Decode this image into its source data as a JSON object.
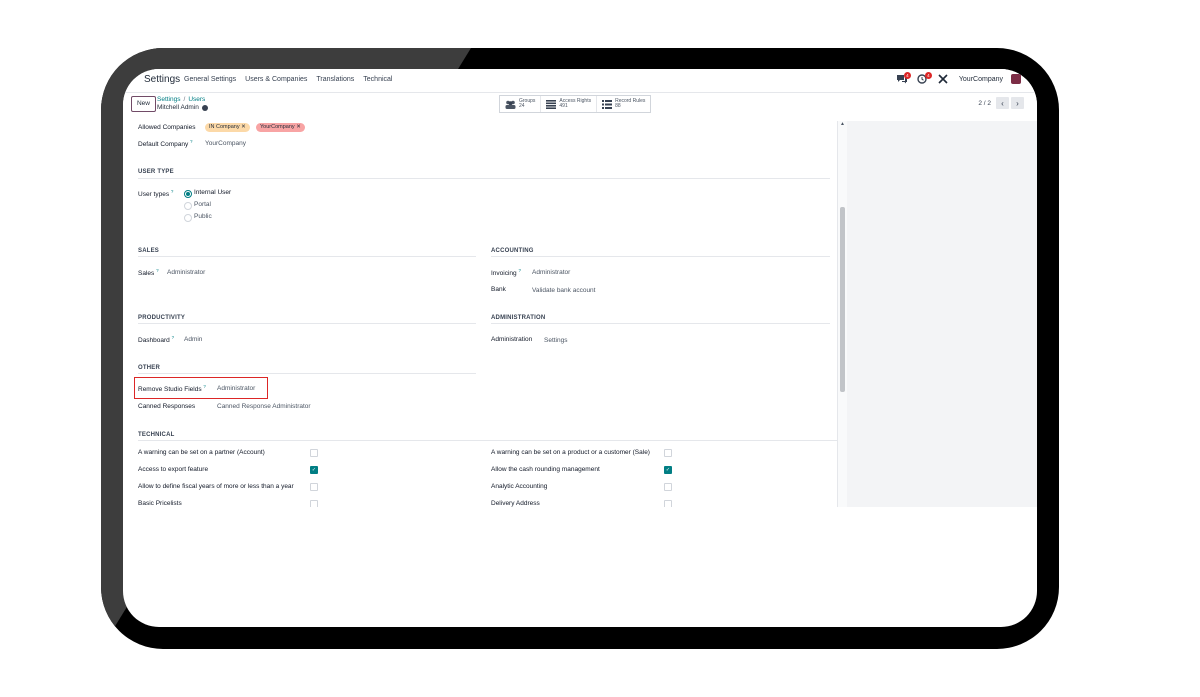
{
  "navbar": {
    "app_name": "Settings",
    "menu": [
      "General Settings",
      "Users & Companies",
      "Translations",
      "Technical"
    ],
    "chat_badge": "4",
    "activity_badge": "4",
    "company": "YourCompany"
  },
  "control": {
    "new_label": "New",
    "breadcrumb": [
      "Settings",
      "Users"
    ],
    "record_name": "Mitchell Admin",
    "smart_buttons": [
      {
        "label": "Groups",
        "value": "24",
        "icon": "users-icon"
      },
      {
        "label": "Access Rights",
        "value": "491",
        "icon": "list-icon"
      },
      {
        "label": "Record Rules",
        "value": "88",
        "icon": "list-icon"
      }
    ],
    "pager": "2 / 2"
  },
  "form": {
    "allowed_companies_label": "Allowed Companies",
    "allowed_companies": [
      "IN Company",
      "YourCompany"
    ],
    "default_company_label": "Default Company",
    "default_company": "YourCompany",
    "user_type_header": "USER TYPE",
    "user_types_label": "User types",
    "user_types": [
      "Internal User",
      "Portal",
      "Public"
    ],
    "selected_user_type": "Internal User",
    "sales_header": "SALES",
    "sales_label": "Sales",
    "sales_value": "Administrator",
    "accounting_header": "ACCOUNTING",
    "invoicing_label": "Invoicing",
    "invoicing_value": "Administrator",
    "bank_label": "Bank",
    "bank_value": "Validate bank account",
    "productivity_header": "PRODUCTIVITY",
    "dashboard_label": "Dashboard",
    "dashboard_value": "Admin",
    "administration_header": "ADMINISTRATION",
    "administration_label": "Administration",
    "administration_value": "Settings",
    "other_header": "OTHER",
    "remove_studio_label": "Remove Studio Fields",
    "remove_studio_value": "Administrator",
    "canned_label": "Canned Responses",
    "canned_value": "Canned Response Administrator",
    "technical_header": "TECHNICAL",
    "technical_left": [
      {
        "label": "A warning can be set on a partner (Account)",
        "checked": false
      },
      {
        "label": "Access to export feature",
        "checked": true
      },
      {
        "label": "Allow to define fiscal years of more or less than a year",
        "checked": false
      },
      {
        "label": "Basic Pricelists",
        "checked": false
      }
    ],
    "technical_right": [
      {
        "label": "A warning can be set on a product or a customer (Sale)",
        "checked": false
      },
      {
        "label": "Allow the cash rounding management",
        "checked": true
      },
      {
        "label": "Analytic Accounting",
        "checked": false
      },
      {
        "label": "Delivery Address",
        "checked": false
      }
    ]
  },
  "colors": {
    "accent": "#017e84",
    "brand": "#714b67",
    "tag_in_company": "#fcd9a8",
    "tag_your_company": "#f8a4a4",
    "highlight": "#dc2626"
  }
}
